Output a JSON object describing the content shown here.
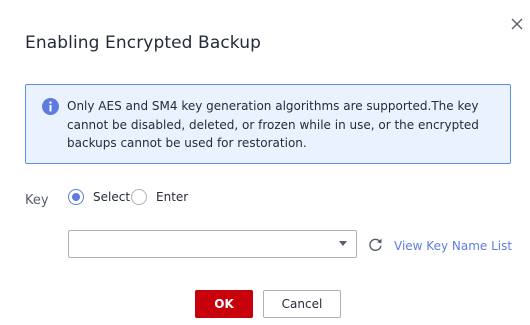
{
  "dialog": {
    "title": "Enabling Encrypted Backup",
    "close_icon": "close-icon"
  },
  "notice": {
    "icon": "info-icon",
    "text": "Only AES and SM4 key generation algorithms are supported.The key cannot be disabled, deleted, or frozen while in use, or the encrypted backups cannot be used for restoration."
  },
  "key": {
    "label": "Key",
    "options": [
      {
        "label": "Select",
        "checked": true
      },
      {
        "label": "Enter",
        "checked": false
      }
    ],
    "select_value": "",
    "refresh_icon": "refresh-icon",
    "view_link": "View Key Name List"
  },
  "buttons": {
    "ok": "OK",
    "cancel": "Cancel"
  },
  "colors": {
    "primary_button": "#c7000b",
    "link": "#5e7ce0",
    "notice_bg": "#ebf2ff",
    "notice_border": "#5e8fe6"
  }
}
